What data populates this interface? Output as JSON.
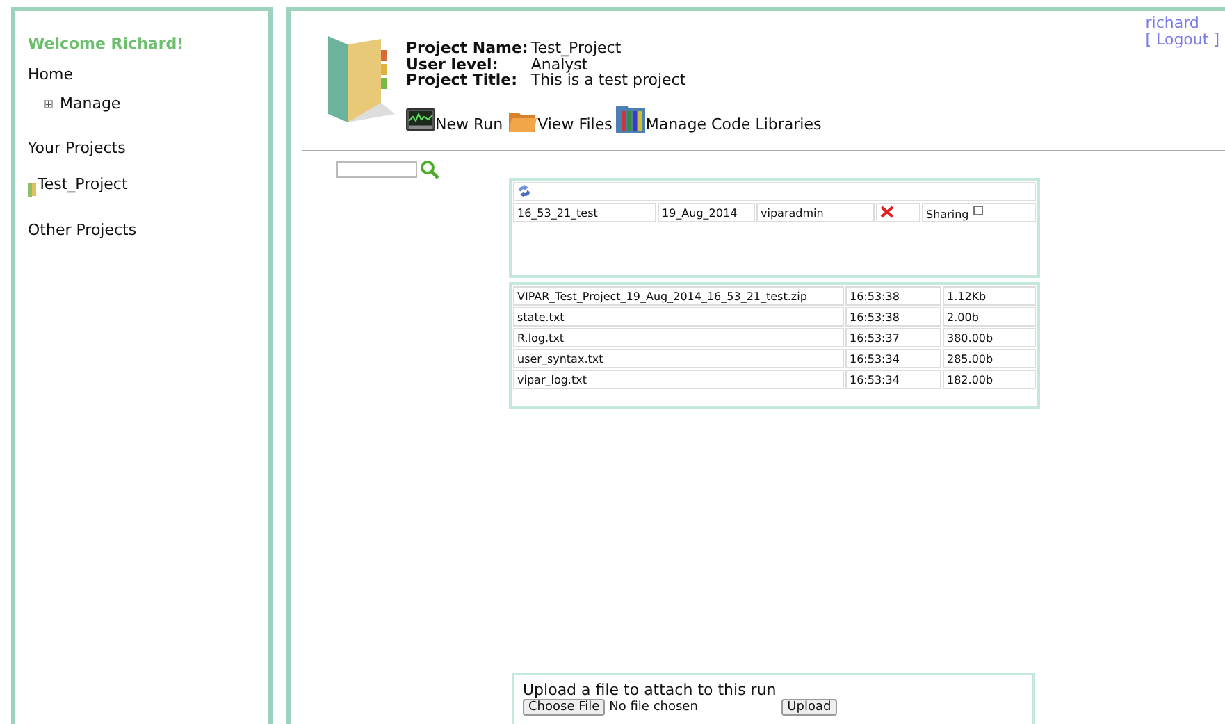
{
  "sidebar": {
    "welcome": "Welcome Richard!",
    "home": "Home",
    "manage": {
      "label": "Manage",
      "expanded": false
    },
    "your_projects": "Your Projects",
    "projects": [
      {
        "label": "Test_Project"
      }
    ],
    "other_projects": "Other Projects"
  },
  "account": {
    "username": "richard",
    "logout": "[ Logout ]"
  },
  "project": {
    "fields": [
      {
        "label": "Project Name:",
        "value": "Test_Project"
      },
      {
        "label": "User level:",
        "value": "Analyst"
      },
      {
        "label": "Project Title:",
        "value": "This is a test project"
      }
    ]
  },
  "toolbar": [
    {
      "kind": "monitor",
      "label": "New Run"
    },
    {
      "kind": "folder",
      "label": "View Files"
    },
    {
      "kind": "books",
      "label": "Manage Code Libraries"
    }
  ],
  "run": {
    "name": "16_53_21_test",
    "date": "19_Aug_2014",
    "owner": "viparadmin",
    "sharing_label": "Sharing",
    "sharing": false
  },
  "files": [
    {
      "name": "VIPAR_Test_Project_19_Aug_2014_16_53_21_test.zip",
      "time": "16:53:38",
      "size": "1.12Kb"
    },
    {
      "name": "state.txt",
      "time": "16:53:38",
      "size": "2.00b"
    },
    {
      "name": "R.log.txt",
      "time": "16:53:37",
      "size": "380.00b"
    },
    {
      "name": "user_syntax.txt",
      "time": "16:53:34",
      "size": "285.00b"
    },
    {
      "name": "vipar_log.txt",
      "time": "16:53:34",
      "size": "182.00b"
    }
  ],
  "upload": {
    "prompt": "Upload a file to attach to this run",
    "choose": "Choose File",
    "no_file": "No file chosen",
    "submit": "Upload"
  }
}
